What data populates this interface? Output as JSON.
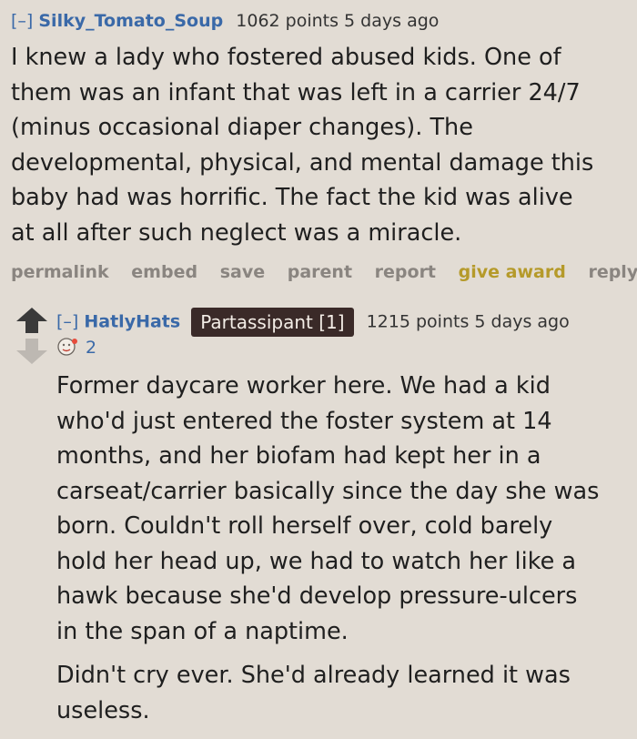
{
  "comment1": {
    "collapse": "[–]",
    "author": "Silky_Tomato_Soup",
    "score": "1062 points 5 days ago",
    "body": [
      "I knew a lady who fostered abused kids. One of",
      "them was an infant that was left in a carrier 24/7",
      "(minus occasional diaper changes). The",
      "developmental, physical, and mental damage this",
      "baby had was horrific. The fact the kid was alive",
      "at all after such neglect was a miracle."
    ],
    "actions": {
      "permalink": "permalink",
      "embed": "embed",
      "save": "save",
      "parent": "parent",
      "report": "report",
      "give_award": "give award",
      "reply": "reply"
    }
  },
  "comment2": {
    "collapse": "[–]",
    "author": "HatlyHats",
    "flair": "Partassipant [1]",
    "score": "1215 points 5 days ago",
    "award_count": "2",
    "award_icon": "award-icon",
    "paragraphs": [
      [
        "Former daycare worker here. We had a kid",
        "who'd just entered the foster system at 14",
        "months, and her biofam had kept her in a",
        "carseat/carrier basically since the day she was",
        "born. Couldn't roll herself over, cold barely",
        "hold her head up, we had to watch her like a",
        "hawk because she'd develop pressure-ulcers",
        "in the span of a naptime."
      ],
      [
        "Didn't cry ever. She'd already learned it was",
        "useless."
      ]
    ]
  },
  "colors": {
    "background": "#e2dcd4",
    "link": "#3a69a8",
    "action": "#8a8580",
    "award": "#b59a2a",
    "flair_bg": "#3a2a28"
  }
}
